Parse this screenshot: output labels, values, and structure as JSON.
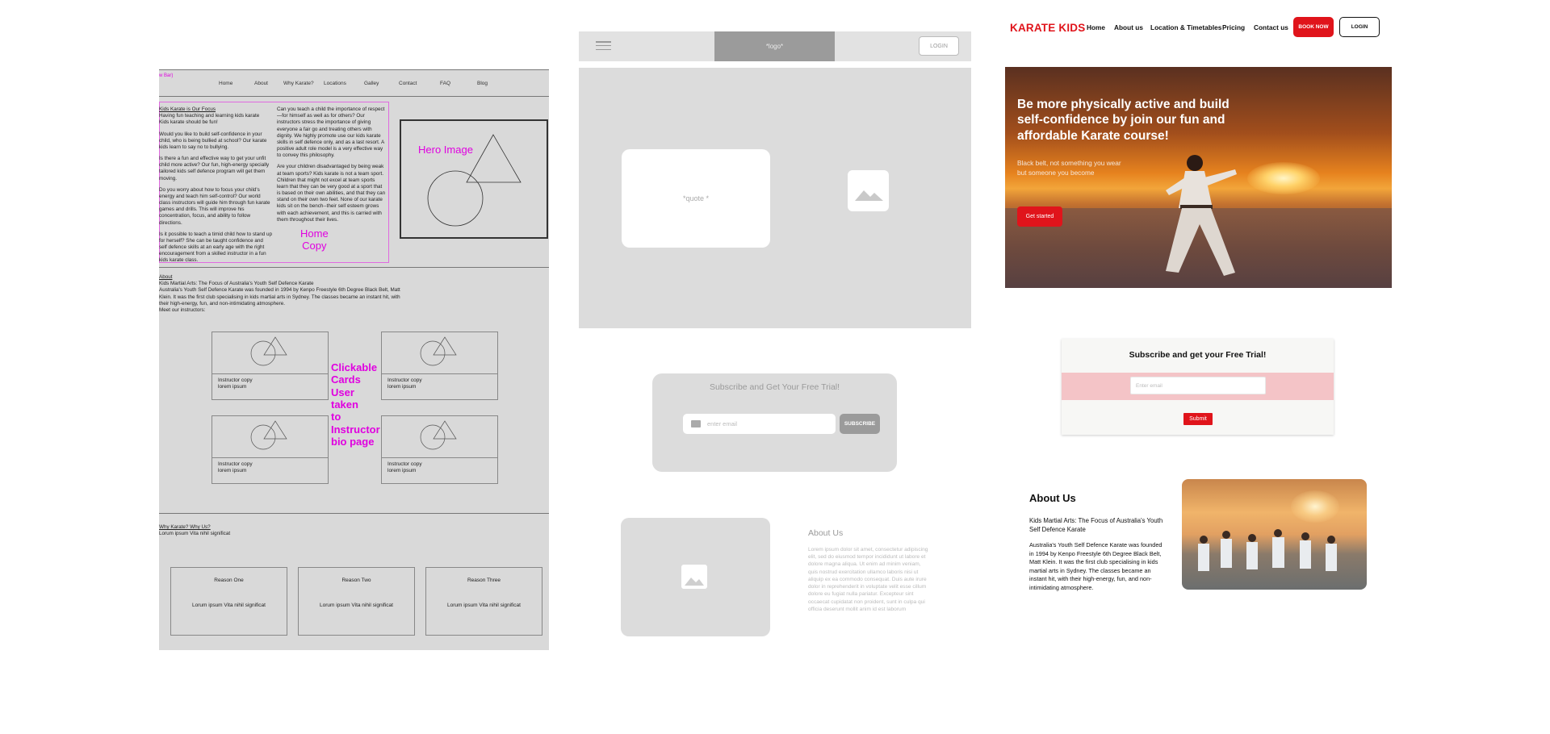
{
  "wireframe1": {
    "navbar_tag": "w Bar)",
    "nav": [
      "Home",
      "About",
      "Why Karate?",
      "Locations",
      "Galley",
      "Contact",
      "FAQ",
      "Blog"
    ],
    "left_col": {
      "heading": "Kids Karate is Our Focus",
      "p1": "Having fun teaching and learning kids karate\nKids karate should be fun!",
      "p2": "Would you like to build self-confidence in your child, who is being bullied at school? Our karate kids learn to say no to bullying.",
      "p3": "Is there a fun and effective way to get your unfit child more active? Our fun, high-energy specially tailored kids self defence program will get them moving.",
      "p4": "Do you worry about how to focus your child's energy and teach him self-control? Our world class instructors will guide him through fun karate games and drills. This will improve his concentration, focus, and ability to follow directions.",
      "p5": "Is it possible to teach a timid child how to stand up for herself? She can be taught confidence and self defence skills at an early age with the right encouragement from a skilled instructor in a fun kids karate class."
    },
    "right_col": {
      "p1": "Can you teach a child the importance of respect—for himself as well as for others? Our instructors stress the importance of giving everyone a fair go and treating others with dignity. We highly promote use our kids karate skills in self defence only, and as a last resort. A positive adult role model is a very effective way to convey this philosophy.",
      "p2": "Are your children disadvantaged by being weak at team sports? Kids karate is not a team sport. Children that might not excel at team sports learn that they can be very good at a sport that is based on their own abilities, and that they can stand on their own two feet. None of our karate kids sit on the bench--their self esteem grows with each achievement, and this is carried with them throughout their lives."
    },
    "home_copy_label": "Home\nCopy",
    "hero_image_label": "Hero Image",
    "about": {
      "heading": "About",
      "sub": "Kids Martial Arts: The Focus of Australia's Youth Self Defence Karate",
      "body": "Australia's Youth Self Defence Karate was founded in 1994 by Kenpo Freestyle 6th Degree Black Belt, Matt Klein. It was the first club specialising in kids martial arts in Sydney. The classes became an instant hit, with their high-energy, fun, and non-intimidating atmosphere.",
      "meet": "Meet our instructors:"
    },
    "instructor_cards": [
      {
        "line1": "Instructor copy",
        "line2": "lorem ipsum"
      },
      {
        "line1": "Instructor copy",
        "line2": "lorem ipsum"
      },
      {
        "line1": "Instructor copy",
        "line2": "lorem ipsum"
      },
      {
        "line1": "Instructor copy",
        "line2": "lorem ipsum"
      }
    ],
    "clickable_note": "Clickable\nCards\nUser\ntaken\nto\nInstructor\nbio page",
    "why": {
      "heading": "Why Karate? Why Us?",
      "body": "Lorum ipsum Vita nihil significat"
    },
    "reasons": [
      {
        "title": "Reason One",
        "body": "Lorum ipsum Vita nihil significat"
      },
      {
        "title": "Reason Two",
        "body": "Lorum ipsum Vita nihil significat"
      },
      {
        "title": "Reason Three",
        "body": "Lorum ipsum Vita nihil significat"
      }
    ]
  },
  "wireframe2": {
    "logo": "*logo*",
    "login": "LOGIN",
    "quote": "*quote *",
    "subscribe": {
      "title": "Subscribe and Get Your Free Trial!",
      "placeholder": "enter email",
      "button": "SUBSCRIBE"
    },
    "about": {
      "heading": "About Us",
      "lorem": "Lorem ipsum dolor sit amet, consectetur adipiscing elit, sed do eiusmod tempor incididunt ut labore et dolore magna aliqua. Ut enim ad minim veniam, quis nostrud exercitation ullamco laboris nisi ut aliquip ex ea commodo consequat. Duis aute irure dolor in reprehenderit in voluptate velit esse cillum dolore eu fugiat nulla pariatur. Excepteur sint occaecat cupidatat non proident, sunt in culpa qui officia deserunt mollit anim id est laborum"
    }
  },
  "hifi": {
    "brand": "KARATE KIDS",
    "nav": [
      "Home",
      "About us",
      "Location & Timetables",
      "Pricing",
      "Contact us"
    ],
    "book_now": "BOOK NOW",
    "login": "LOGIN",
    "hero": {
      "headline": "Be more physically active and build self-confidence by join our fun and affordable Karate course!",
      "tagline": "Black belt, not something you wear but someone you become",
      "cta": "Get started"
    },
    "subscribe": {
      "title": "Subscribe and get your Free Trial!",
      "placeholder": "Enter email",
      "button": "Submit"
    },
    "about": {
      "heading": "About Us",
      "sub": "Kids Martial Arts: The Focus of Australia's Youth Self Defence Karate",
      "body": "Australia's Youth Self Defence Karate was founded in 1994 by Kenpo Freestyle 6th Degree Black Belt, Matt Klein. It was the first club specialising in kids martial arts in Sydney. The classes became an instant hit, with their high-energy, fun, and non-intimidating atmosphere."
    },
    "colors": {
      "accent": "#e0141b",
      "wireframe_note": "#e000e0"
    }
  }
}
